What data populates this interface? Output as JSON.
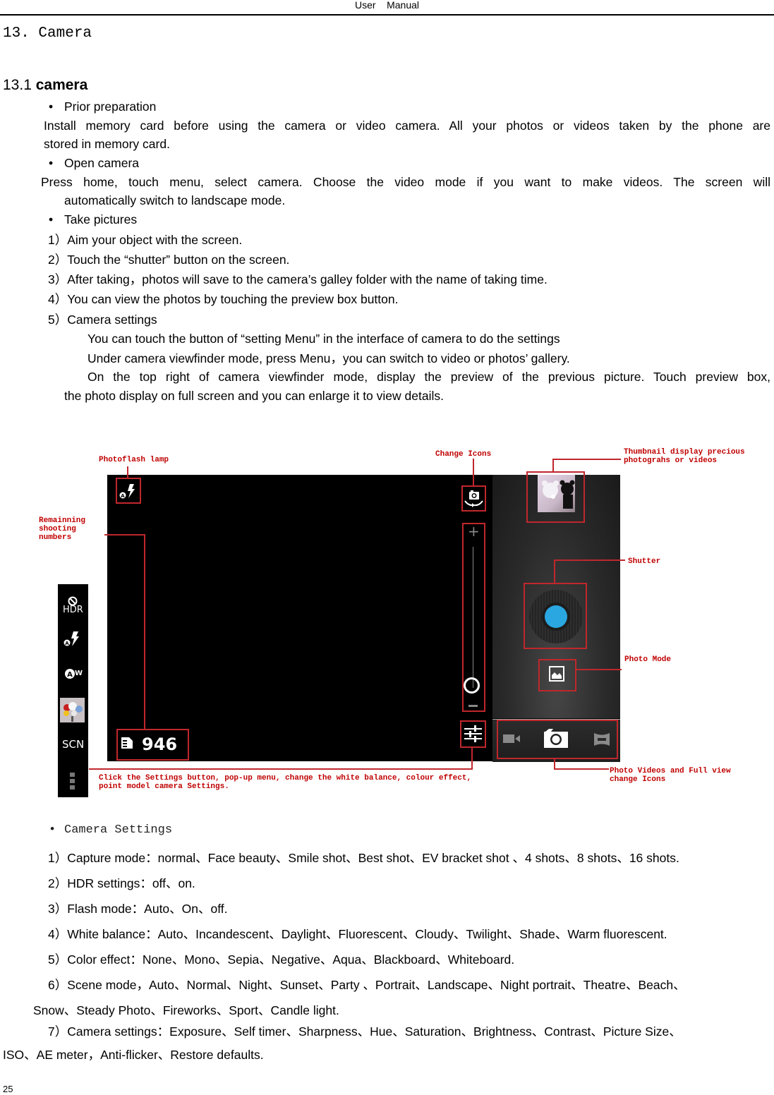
{
  "header": {
    "title": "User    Manual"
  },
  "chapter": {
    "number": "13.",
    "title": "Camera"
  },
  "section": {
    "number": "13.1",
    "title": "camera"
  },
  "prior_preparation": {
    "heading": "Prior preparation",
    "line1": "Install memory card before using the camera or video camera. All your photos or videos taken by the phone are",
    "line2": "stored in memory card."
  },
  "open_camera": {
    "heading": "Open camera",
    "line1": "Press home, touch menu, select camera. Choose the video mode if you want to make videos. The screen will",
    "line2": "automatically switch to landscape mode."
  },
  "take_pictures": {
    "heading": "Take pictures",
    "steps": [
      "1）Aim your object with the screen.",
      "2）Touch the “shutter” button on the screen.",
      "3）After taking，photos will save to the camera’s galley folder with the name of taking time.",
      "4）You can view the photos by touching the preview box button.",
      "5）Camera settings"
    ],
    "settings_notes": [
      "You can touch the button of “setting Menu” in the interface of camera to do the settings",
      "Under camera viewfinder mode, press Menu，you can switch to video or photos’ gallery.",
      "On the top right of camera viewfinder mode, display the preview of the previous picture. Touch preview box,",
      "the photo display on full screen and you can enlarge it to view details."
    ]
  },
  "figure": {
    "labels": {
      "photoflash": "Photoflash lamp",
      "remaining": [
        "Remainning",
        "shooting",
        "numbers"
      ],
      "change_icons": "Change Icons",
      "thumbnail": [
        "Thumbnail display precious",
        "photograhs or videos"
      ],
      "shutter": "Shutter",
      "photo_mode": "Photo Mode",
      "mode_switch": [
        "Photo Videos and Full view",
        "change Icons"
      ],
      "settings": [
        "Click the Settings button, pop-up menu, change the white balance, colour effect,",
        "point model camera Settings."
      ]
    },
    "remaining_count": "946",
    "sidebar": {
      "hdr": "HDR",
      "awb": "W",
      "scn": "SCN"
    },
    "zoom_plus": "+",
    "colors": {
      "accent_blue": "#2aa7e0",
      "annotation_red": "#c0272d"
    }
  },
  "camera_settings": {
    "heading": "Camera Settings",
    "items": [
      "1）Capture mode：normal、Face beauty、Smile shot、Best shot、EV bracket shot  、4 shots、8 shots、16 shots.",
      "2）HDR settings：off、on.",
      "3）Flash mode：Auto、On、off.",
      "4）White balance：Auto、Incandescent、Daylight、Fluorescent、Cloudy、Twilight、Shade、Warm fluorescent.",
      "5）Color effect：None、Mono、Sepia、Negative、Aqua、Blackboard、Whiteboard.",
      "6）Scene mode，Auto、Normal、Night、Sunset、Party  、Portrait、Landscape、Night portrait、Theatre、Beach、",
      "Snow、Steady Photo、Fireworks、Sport、Candle light.",
      "7）Camera settings：Exposure、Self timer、Sharpness、Hue、Saturation、Brightness、Contrast、Picture Size、",
      "ISO、AE meter，Anti-flicker、Restore defaults."
    ]
  },
  "footer": {
    "page_number": "25"
  }
}
